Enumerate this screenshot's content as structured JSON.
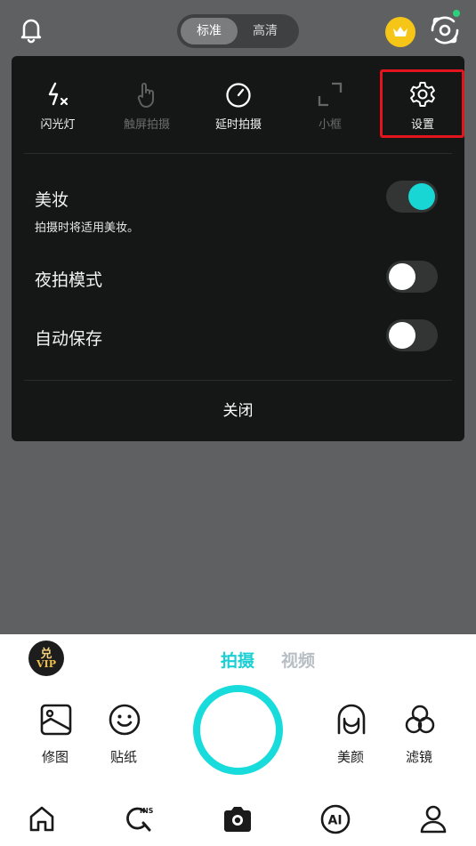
{
  "top": {
    "quality_options": [
      "标准",
      "高清"
    ],
    "quality_selected": "标准",
    "icons": [
      "bell-icon",
      "crown-icon",
      "camera-flip-icon"
    ]
  },
  "panel": {
    "tools": [
      {
        "label": "闪光灯",
        "icon": "flash-off-icon",
        "enabled": true
      },
      {
        "label": "触屏拍摄",
        "icon": "touch-hand-icon",
        "enabled": false
      },
      {
        "label": "延时拍摄",
        "icon": "timer-icon",
        "enabled": true
      },
      {
        "label": "小框",
        "icon": "frame-corners-icon",
        "enabled": false
      },
      {
        "label": "设置",
        "icon": "gear-icon",
        "enabled": true,
        "highlighted": true
      }
    ],
    "settings": [
      {
        "title": "美妆",
        "desc": "拍摄时将适用美妆。",
        "on": true
      },
      {
        "title": "夜拍模式",
        "on": false
      },
      {
        "title": "自动保存",
        "on": false
      }
    ],
    "close_label": "关闭"
  },
  "bottom": {
    "vip_top": "兑",
    "vip_bottom": "VIP",
    "modes": [
      "拍摄",
      "视频"
    ],
    "active_mode": "拍摄",
    "tools": [
      "修图",
      "贴纸",
      "美颜",
      "滤镜"
    ],
    "nav_icons": [
      "home-icon",
      "ins-search-icon",
      "camera-icon",
      "ai-icon",
      "profile-icon"
    ]
  },
  "colors": {
    "accent": "#18dbdb",
    "highlight": "#e3141b",
    "panel": "#151616",
    "backdrop": "#5f6061",
    "crown": "#f5c518"
  }
}
